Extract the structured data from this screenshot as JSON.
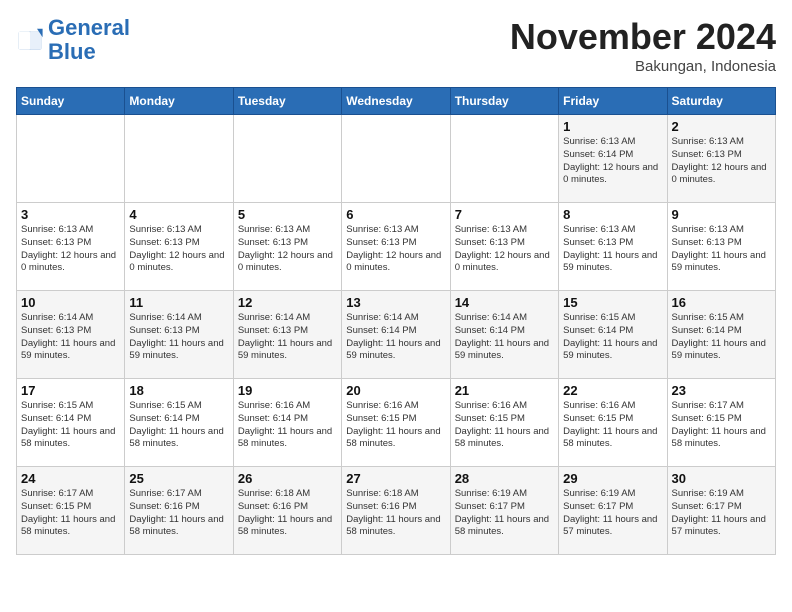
{
  "header": {
    "logo_line1": "General",
    "logo_line2": "Blue",
    "title": "November 2024",
    "subtitle": "Bakungan, Indonesia"
  },
  "days_of_week": [
    "Sunday",
    "Monday",
    "Tuesday",
    "Wednesday",
    "Thursday",
    "Friday",
    "Saturday"
  ],
  "weeks": [
    [
      {
        "day": null
      },
      {
        "day": null
      },
      {
        "day": null
      },
      {
        "day": null
      },
      {
        "day": null
      },
      {
        "day": 1,
        "info": "Sunrise: 6:13 AM\nSunset: 6:14 PM\nDaylight: 12 hours and 0 minutes."
      },
      {
        "day": 2,
        "info": "Sunrise: 6:13 AM\nSunset: 6:13 PM\nDaylight: 12 hours and 0 minutes."
      }
    ],
    [
      {
        "day": 3,
        "info": "Sunrise: 6:13 AM\nSunset: 6:13 PM\nDaylight: 12 hours and 0 minutes."
      },
      {
        "day": 4,
        "info": "Sunrise: 6:13 AM\nSunset: 6:13 PM\nDaylight: 12 hours and 0 minutes."
      },
      {
        "day": 5,
        "info": "Sunrise: 6:13 AM\nSunset: 6:13 PM\nDaylight: 12 hours and 0 minutes."
      },
      {
        "day": 6,
        "info": "Sunrise: 6:13 AM\nSunset: 6:13 PM\nDaylight: 12 hours and 0 minutes."
      },
      {
        "day": 7,
        "info": "Sunrise: 6:13 AM\nSunset: 6:13 PM\nDaylight: 12 hours and 0 minutes."
      },
      {
        "day": 8,
        "info": "Sunrise: 6:13 AM\nSunset: 6:13 PM\nDaylight: 11 hours and 59 minutes."
      },
      {
        "day": 9,
        "info": "Sunrise: 6:13 AM\nSunset: 6:13 PM\nDaylight: 11 hours and 59 minutes."
      }
    ],
    [
      {
        "day": 10,
        "info": "Sunrise: 6:14 AM\nSunset: 6:13 PM\nDaylight: 11 hours and 59 minutes."
      },
      {
        "day": 11,
        "info": "Sunrise: 6:14 AM\nSunset: 6:13 PM\nDaylight: 11 hours and 59 minutes."
      },
      {
        "day": 12,
        "info": "Sunrise: 6:14 AM\nSunset: 6:13 PM\nDaylight: 11 hours and 59 minutes."
      },
      {
        "day": 13,
        "info": "Sunrise: 6:14 AM\nSunset: 6:14 PM\nDaylight: 11 hours and 59 minutes."
      },
      {
        "day": 14,
        "info": "Sunrise: 6:14 AM\nSunset: 6:14 PM\nDaylight: 11 hours and 59 minutes."
      },
      {
        "day": 15,
        "info": "Sunrise: 6:15 AM\nSunset: 6:14 PM\nDaylight: 11 hours and 59 minutes."
      },
      {
        "day": 16,
        "info": "Sunrise: 6:15 AM\nSunset: 6:14 PM\nDaylight: 11 hours and 59 minutes."
      }
    ],
    [
      {
        "day": 17,
        "info": "Sunrise: 6:15 AM\nSunset: 6:14 PM\nDaylight: 11 hours and 58 minutes."
      },
      {
        "day": 18,
        "info": "Sunrise: 6:15 AM\nSunset: 6:14 PM\nDaylight: 11 hours and 58 minutes."
      },
      {
        "day": 19,
        "info": "Sunrise: 6:16 AM\nSunset: 6:14 PM\nDaylight: 11 hours and 58 minutes."
      },
      {
        "day": 20,
        "info": "Sunrise: 6:16 AM\nSunset: 6:15 PM\nDaylight: 11 hours and 58 minutes."
      },
      {
        "day": 21,
        "info": "Sunrise: 6:16 AM\nSunset: 6:15 PM\nDaylight: 11 hours and 58 minutes."
      },
      {
        "day": 22,
        "info": "Sunrise: 6:16 AM\nSunset: 6:15 PM\nDaylight: 11 hours and 58 minutes."
      },
      {
        "day": 23,
        "info": "Sunrise: 6:17 AM\nSunset: 6:15 PM\nDaylight: 11 hours and 58 minutes."
      }
    ],
    [
      {
        "day": 24,
        "info": "Sunrise: 6:17 AM\nSunset: 6:15 PM\nDaylight: 11 hours and 58 minutes."
      },
      {
        "day": 25,
        "info": "Sunrise: 6:17 AM\nSunset: 6:16 PM\nDaylight: 11 hours and 58 minutes."
      },
      {
        "day": 26,
        "info": "Sunrise: 6:18 AM\nSunset: 6:16 PM\nDaylight: 11 hours and 58 minutes."
      },
      {
        "day": 27,
        "info": "Sunrise: 6:18 AM\nSunset: 6:16 PM\nDaylight: 11 hours and 58 minutes."
      },
      {
        "day": 28,
        "info": "Sunrise: 6:19 AM\nSunset: 6:17 PM\nDaylight: 11 hours and 58 minutes."
      },
      {
        "day": 29,
        "info": "Sunrise: 6:19 AM\nSunset: 6:17 PM\nDaylight: 11 hours and 57 minutes."
      },
      {
        "day": 30,
        "info": "Sunrise: 6:19 AM\nSunset: 6:17 PM\nDaylight: 11 hours and 57 minutes."
      }
    ]
  ]
}
